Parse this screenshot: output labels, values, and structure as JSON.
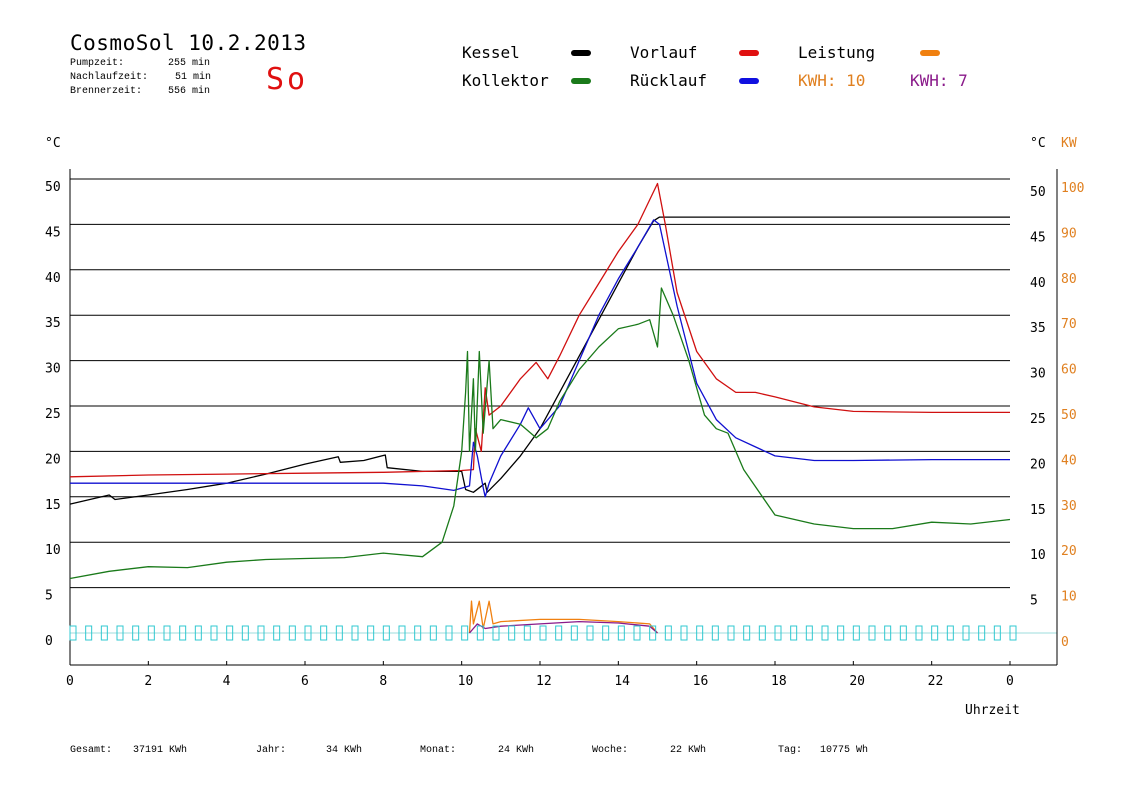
{
  "header": {
    "title": "CosmoSol 10.2.2013",
    "day": "So",
    "stats": [
      {
        "label": "Pumpzeit:",
        "value": "255 min"
      },
      {
        "label": "Nachlaufzeit:",
        "value": "51 min"
      },
      {
        "label": "Brennerzeit:",
        "value": "556 min"
      }
    ]
  },
  "legend": {
    "kessel": {
      "label": "Kessel",
      "color": "#000000"
    },
    "kollektor": {
      "label": "Kollektor",
      "color": "#1a7a1a"
    },
    "vorlauf": {
      "label": "Vorlauf",
      "color": "#d01010"
    },
    "ruecklauf": {
      "label": "Rücklauf",
      "color": "#1010d0"
    },
    "leistung": {
      "label": "Leistung",
      "color": "#f08010"
    },
    "kwh1": {
      "label": "KWH: 10",
      "color": "#e08020"
    },
    "kwh2": {
      "label": "KWH: 7",
      "color": "#8a1a8a"
    }
  },
  "footer": {
    "gesamt_label": "Gesamt:",
    "gesamt_value": "37191 KWh",
    "jahr_label": "Jahr:",
    "jahr_value": "34 KWh",
    "monat_label": "Monat:",
    "monat_value": "24 KWh",
    "woche_label": "Woche:",
    "woche_value": "22 KWh",
    "tag_label": "Tag:",
    "tag_value": "10775 Wh"
  },
  "chart_data": {
    "type": "line",
    "xlabel": "Uhrzeit",
    "ylabel_left": "°C",
    "ylabel_right_temp": "°C",
    "ylabel_right_power": "KW",
    "xlim": [
      0,
      24
    ],
    "ylim": [
      0,
      50
    ],
    "ylim_power": [
      0,
      100
    ],
    "grid": "horizontal",
    "x_ticks": [
      0,
      2,
      4,
      6,
      8,
      10,
      12,
      14,
      16,
      18,
      20,
      22,
      24
    ],
    "x_tick_labels": [
      "0",
      "2",
      "4",
      "6",
      "8",
      "10",
      "12",
      "14",
      "16",
      "18",
      "20",
      "22",
      "0"
    ],
    "y_ticks": [
      0,
      5,
      10,
      15,
      20,
      25,
      30,
      35,
      40,
      45,
      50
    ],
    "power_ticks": [
      0,
      10,
      20,
      30,
      40,
      50,
      60,
      70,
      80,
      90,
      100
    ],
    "series": [
      {
        "key": "kessel",
        "color": "#000000",
        "points": [
          [
            0,
            14.2
          ],
          [
            1,
            15.2
          ],
          [
            1.15,
            14.7
          ],
          [
            2,
            15.2
          ],
          [
            3,
            15.8
          ],
          [
            4,
            16.5
          ],
          [
            5,
            17.5
          ],
          [
            6,
            18.6
          ],
          [
            6.85,
            19.4
          ],
          [
            6.9,
            18.8
          ],
          [
            7.5,
            19.0
          ],
          [
            8.05,
            19.6
          ],
          [
            8.1,
            18.2
          ],
          [
            9,
            17.8
          ],
          [
            9.9,
            17.8
          ],
          [
            10,
            17.8
          ],
          [
            10.1,
            15.8
          ],
          [
            10.3,
            15.5
          ],
          [
            10.6,
            16.5
          ],
          [
            10.65,
            15.5
          ],
          [
            11,
            17.0
          ],
          [
            11.5,
            19.5
          ],
          [
            12,
            22.5
          ],
          [
            12.5,
            26.5
          ],
          [
            13,
            30.5
          ],
          [
            13.5,
            34.5
          ],
          [
            14,
            38.5
          ],
          [
            14.5,
            42.5
          ],
          [
            14.9,
            45.4
          ],
          [
            15.05,
            45.8
          ],
          [
            24,
            45.8
          ]
        ]
      },
      {
        "key": "vorlauf",
        "color": "#d01010",
        "points": [
          [
            0,
            17.2
          ],
          [
            2,
            17.4
          ],
          [
            4,
            17.5
          ],
          [
            6,
            17.6
          ],
          [
            8,
            17.7
          ],
          [
            10,
            17.9
          ],
          [
            10.3,
            18.0
          ],
          [
            10.35,
            22.5
          ],
          [
            10.5,
            20.0
          ],
          [
            10.6,
            27.0
          ],
          [
            10.7,
            24.0
          ],
          [
            11,
            25.0
          ],
          [
            11.5,
            28.0
          ],
          [
            11.9,
            29.8
          ],
          [
            12.2,
            28.0
          ],
          [
            12.5,
            30.5
          ],
          [
            13,
            35.0
          ],
          [
            13.5,
            38.5
          ],
          [
            14,
            42.0
          ],
          [
            14.5,
            45.0
          ],
          [
            15,
            49.5
          ],
          [
            15.2,
            45.0
          ],
          [
            15.5,
            37.5
          ],
          [
            16,
            31.0
          ],
          [
            16.5,
            28.0
          ],
          [
            17,
            26.5
          ],
          [
            17.5,
            26.5
          ],
          [
            18,
            26.0
          ],
          [
            19,
            24.9
          ],
          [
            20,
            24.4
          ],
          [
            22,
            24.3
          ],
          [
            24,
            24.3
          ]
        ]
      },
      {
        "key": "ruecklauf",
        "color": "#1010d0",
        "points": [
          [
            0,
            16.5
          ],
          [
            2,
            16.5
          ],
          [
            4,
            16.5
          ],
          [
            6,
            16.5
          ],
          [
            8,
            16.5
          ],
          [
            9,
            16.2
          ],
          [
            9.8,
            15.7
          ],
          [
            10.2,
            16.2
          ],
          [
            10.3,
            21.0
          ],
          [
            10.4,
            19.5
          ],
          [
            10.55,
            16.0
          ],
          [
            10.6,
            15.0
          ],
          [
            10.7,
            16.5
          ],
          [
            11,
            19.5
          ],
          [
            11.5,
            23.0
          ],
          [
            11.7,
            24.8
          ],
          [
            12,
            22.5
          ],
          [
            12.5,
            25.0
          ],
          [
            13,
            30.0
          ],
          [
            13.5,
            35.0
          ],
          [
            14,
            39.0
          ],
          [
            14.5,
            42.5
          ],
          [
            14.9,
            45.5
          ],
          [
            15.05,
            45.0
          ],
          [
            15.5,
            36.0
          ],
          [
            16,
            27.5
          ],
          [
            16.5,
            23.5
          ],
          [
            17,
            21.5
          ],
          [
            17.5,
            20.5
          ],
          [
            18,
            19.5
          ],
          [
            19,
            19.0
          ],
          [
            20,
            19.0
          ],
          [
            22,
            19.1
          ],
          [
            24,
            19.1
          ]
        ]
      },
      {
        "key": "kollektor",
        "color": "#1a7a1a",
        "points": [
          [
            0,
            6.0
          ],
          [
            1,
            6.8
          ],
          [
            2,
            7.3
          ],
          [
            3,
            7.2
          ],
          [
            4,
            7.8
          ],
          [
            5,
            8.1
          ],
          [
            6,
            8.2
          ],
          [
            7,
            8.3
          ],
          [
            8,
            8.8
          ],
          [
            9,
            8.4
          ],
          [
            9.5,
            10.0
          ],
          [
            9.8,
            14.0
          ],
          [
            10,
            20.0
          ],
          [
            10.1,
            26.5
          ],
          [
            10.15,
            31.0
          ],
          [
            10.2,
            20.0
          ],
          [
            10.3,
            28.0
          ],
          [
            10.35,
            20.0
          ],
          [
            10.45,
            31.0
          ],
          [
            10.55,
            22.0
          ],
          [
            10.7,
            30.0
          ],
          [
            10.8,
            22.5
          ],
          [
            11,
            23.5
          ],
          [
            11.5,
            23.0
          ],
          [
            11.9,
            21.5
          ],
          [
            12.2,
            22.5
          ],
          [
            12.5,
            25.5
          ],
          [
            13,
            29.0
          ],
          [
            13.5,
            31.5
          ],
          [
            14,
            33.5
          ],
          [
            14.5,
            34.0
          ],
          [
            14.8,
            34.5
          ],
          [
            15.0,
            31.5
          ],
          [
            15.1,
            38.0
          ],
          [
            15.4,
            35.0
          ],
          [
            15.8,
            30.0
          ],
          [
            16.2,
            24.0
          ],
          [
            16.5,
            22.5
          ],
          [
            16.8,
            22.0
          ],
          [
            17.2,
            18.0
          ],
          [
            17.6,
            15.5
          ],
          [
            18,
            13.0
          ],
          [
            19,
            12.0
          ],
          [
            20,
            11.5
          ],
          [
            21,
            11.5
          ],
          [
            22,
            12.2
          ],
          [
            23,
            12.0
          ],
          [
            24,
            12.5
          ]
        ]
      },
      {
        "key": "leistung",
        "color": "#f08010",
        "axis": "power",
        "points": [
          [
            10.2,
            0
          ],
          [
            10.25,
            7
          ],
          [
            10.3,
            2
          ],
          [
            10.45,
            7
          ],
          [
            10.55,
            1
          ],
          [
            10.7,
            7
          ],
          [
            10.8,
            2
          ],
          [
            11,
            2.5
          ],
          [
            12,
            3
          ],
          [
            13,
            3
          ],
          [
            14,
            2.5
          ],
          [
            14.8,
            2
          ],
          [
            15,
            0
          ]
        ]
      },
      {
        "key": "kwh2",
        "color": "#8a1a8a",
        "axis": "power",
        "points": [
          [
            10.2,
            0
          ],
          [
            10.4,
            2
          ],
          [
            10.6,
            1
          ],
          [
            11,
            1.5
          ],
          [
            12,
            2
          ],
          [
            13,
            2.5
          ],
          [
            14,
            2.2
          ],
          [
            14.8,
            1.5
          ],
          [
            15,
            0
          ]
        ]
      }
    ]
  }
}
